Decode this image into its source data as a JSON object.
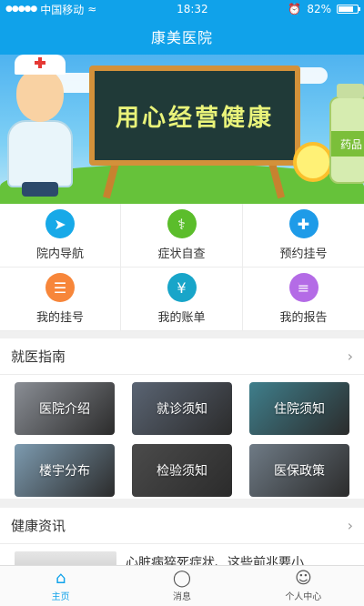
{
  "status_bar": {
    "signal": "●●●●●",
    "carrier": "中国移动",
    "wifi": "≈",
    "time": "18:32",
    "battery_text": "82%",
    "battery_level": 0.82
  },
  "navbar": {
    "title": "康美医院"
  },
  "banner": {
    "slogan": "用心经营健康",
    "bottle_label": "药品"
  },
  "quick_actions": [
    {
      "label": "院内导航",
      "icon": "navigation-icon",
      "color": "#17a9e8",
      "glyph": "➤"
    },
    {
      "label": "症状自查",
      "icon": "stethoscope-icon",
      "color": "#5bbd2b",
      "glyph": "⚕"
    },
    {
      "label": "预约挂号",
      "icon": "medical-cross-icon",
      "color": "#1e9be8",
      "glyph": "✚"
    },
    {
      "label": "我的挂号",
      "icon": "appointment-doc-icon",
      "color": "#f7863a",
      "glyph": "☰"
    },
    {
      "label": "我的账单",
      "icon": "bill-icon",
      "color": "#18a5c9",
      "glyph": "¥"
    },
    {
      "label": "我的报告",
      "icon": "report-icon",
      "color": "#b46be6",
      "glyph": "≡"
    }
  ],
  "guide": {
    "title": "就医指南",
    "chevron": "›",
    "tiles": [
      {
        "label": "医院介绍",
        "bg": "#8a8e95"
      },
      {
        "label": "就诊须知",
        "bg": "#5a6473"
      },
      {
        "label": "住院须知",
        "bg": "#3f7f8c"
      },
      {
        "label": "楼宇分布",
        "bg": "#7d9bb0"
      },
      {
        "label": "检验须知",
        "bg": "#4b4b4b"
      },
      {
        "label": "医保政策",
        "bg": "#6f7b86"
      }
    ]
  },
  "news": {
    "title": "健康资讯",
    "chevron": "›",
    "items": [
      {
        "title": "心脏病猝死症状、这些前兆要小..."
      }
    ]
  },
  "tabbar": [
    {
      "label": "主页",
      "icon": "home-icon",
      "glyph": "⌂",
      "active": true
    },
    {
      "label": "消息",
      "icon": "chat-bubble-icon",
      "glyph": "◯",
      "active": false
    },
    {
      "label": "个人中心",
      "icon": "user-icon",
      "glyph": "☺",
      "active": false
    }
  ]
}
